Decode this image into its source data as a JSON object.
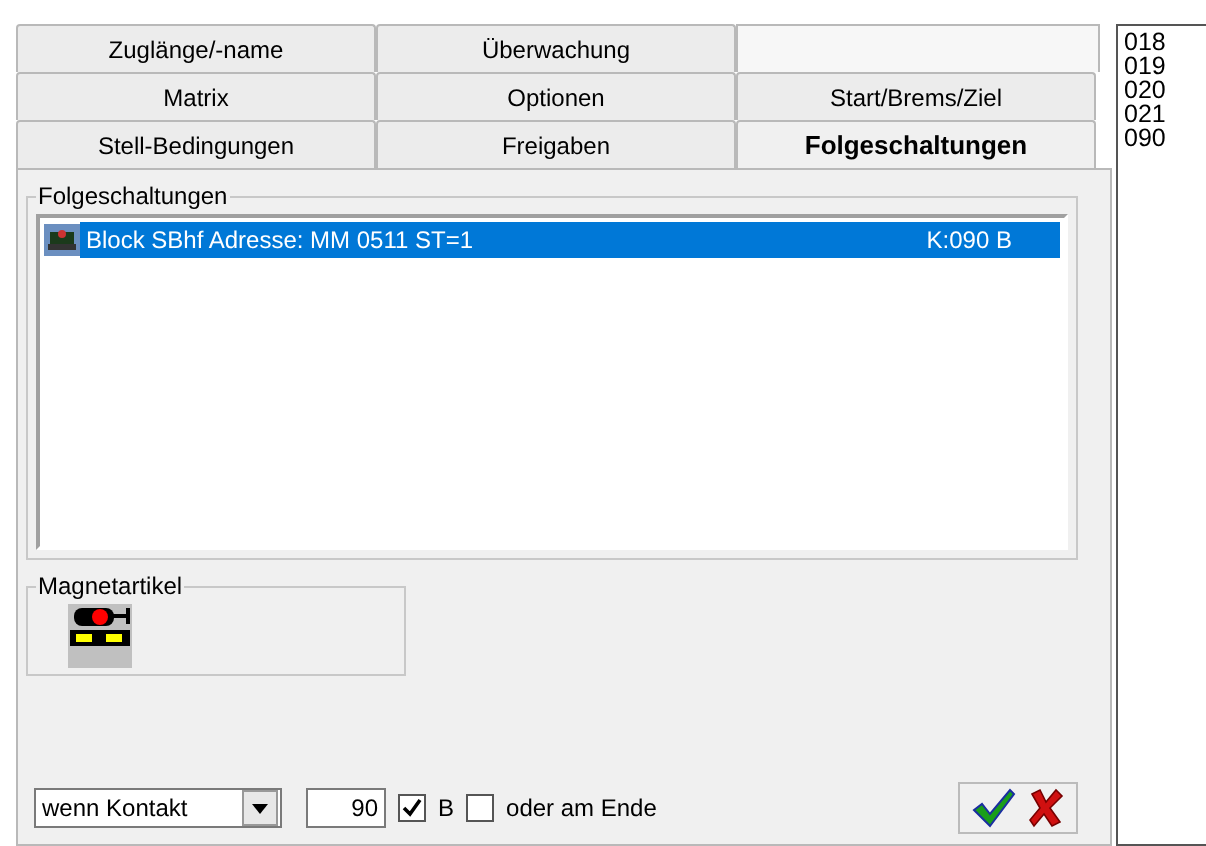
{
  "tab_rows": [
    [
      {
        "label": "Zuglänge/-name",
        "selected": false
      },
      {
        "label": "Überwachung",
        "selected": false
      }
    ],
    [
      {
        "label": "Matrix",
        "selected": false
      },
      {
        "label": "Optionen",
        "selected": false
      },
      {
        "label": "Start/Brems/Ziel",
        "selected": false
      }
    ],
    [
      {
        "label": "Stell-Bedingungen",
        "selected": false
      },
      {
        "label": "Freigaben",
        "selected": false
      },
      {
        "label": "Folgeschaltungen",
        "selected": true
      }
    ]
  ],
  "folgeschaltungen": {
    "title": "Folgeschaltungen",
    "items": [
      {
        "text": "Block SBhf Adresse: MM 0511 ST=1",
        "contact": "K:090 B",
        "selected": true
      }
    ]
  },
  "magnetartikel": {
    "title": "Magnetartikel"
  },
  "bottom": {
    "condition": "wenn Kontakt",
    "value": "90",
    "b_checkbox": {
      "label": "B",
      "checked": true
    },
    "end_checkbox": {
      "label": "oder am Ende",
      "checked": false
    }
  },
  "side_list": [
    "018",
    "019",
    "020",
    "021",
    "090"
  ]
}
